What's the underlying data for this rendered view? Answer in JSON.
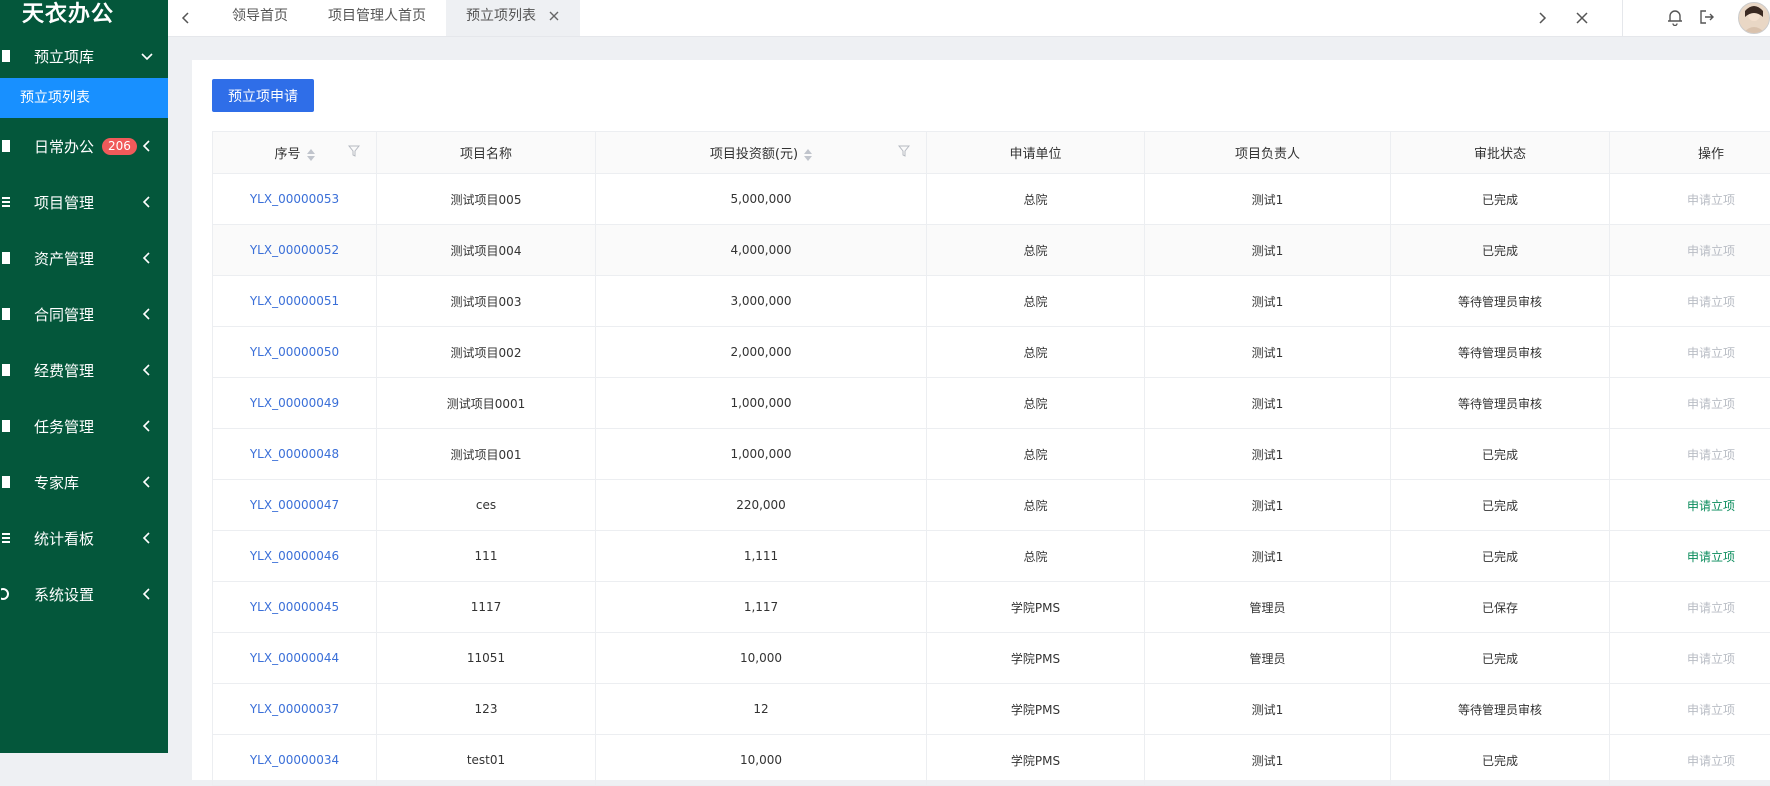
{
  "app": {
    "brand": "天衣办公"
  },
  "sidebar": {
    "items": [
      {
        "label": "预立项库",
        "icon": "book-icon",
        "expanded": true
      },
      {
        "label": "日常办公",
        "icon": "book-icon",
        "badge": "206"
      },
      {
        "label": "项目管理",
        "icon": "list-icon"
      },
      {
        "label": "资产管理",
        "icon": "book-icon"
      },
      {
        "label": "合同管理",
        "icon": "book-icon"
      },
      {
        "label": "经费管理",
        "icon": "book-icon"
      },
      {
        "label": "任务管理",
        "icon": "book-icon"
      },
      {
        "label": "专家库",
        "icon": "book-icon"
      },
      {
        "label": "统计看板",
        "icon": "list-icon"
      },
      {
        "label": "系统设置",
        "icon": "gear-icon"
      }
    ],
    "active_sub": "预立项列表"
  },
  "tabs": [
    {
      "label": "领导首页"
    },
    {
      "label": "项目管理人首页"
    },
    {
      "label": "预立项列表",
      "active": true
    }
  ],
  "toolbar": {
    "apply_label": "预立项申请"
  },
  "table": {
    "headers": {
      "seq": "序号",
      "name": "项目名称",
      "amount": "项目投资额(元)",
      "unit": "申请单位",
      "leader": "项目负责人",
      "status": "审批状态",
      "op": "操作"
    },
    "rows": [
      {
        "id": "YLX_00000053",
        "name": "测试项目005",
        "amount": "5,000,000",
        "unit": "总院",
        "leader": "测试1",
        "status": "已完成",
        "op": "申请立项",
        "op_enabled": false
      },
      {
        "id": "YLX_00000052",
        "name": "测试项目004",
        "amount": "4,000,000",
        "unit": "总院",
        "leader": "测试1",
        "status": "已完成",
        "op": "申请立项",
        "op_enabled": false
      },
      {
        "id": "YLX_00000051",
        "name": "测试项目003",
        "amount": "3,000,000",
        "unit": "总院",
        "leader": "测试1",
        "status": "等待管理员审核",
        "op": "申请立项",
        "op_enabled": false
      },
      {
        "id": "YLX_00000050",
        "name": "测试项目002",
        "amount": "2,000,000",
        "unit": "总院",
        "leader": "测试1",
        "status": "等待管理员审核",
        "op": "申请立项",
        "op_enabled": false
      },
      {
        "id": "YLX_00000049",
        "name": "测试项目0001",
        "amount": "1,000,000",
        "unit": "总院",
        "leader": "测试1",
        "status": "等待管理员审核",
        "op": "申请立项",
        "op_enabled": false
      },
      {
        "id": "YLX_00000048",
        "name": "测试项目001",
        "amount": "1,000,000",
        "unit": "总院",
        "leader": "测试1",
        "status": "已完成",
        "op": "申请立项",
        "op_enabled": false
      },
      {
        "id": "YLX_00000047",
        "name": "ces",
        "amount": "220,000",
        "unit": "总院",
        "leader": "测试1",
        "status": "已完成",
        "op": "申请立项",
        "op_enabled": true
      },
      {
        "id": "YLX_00000046",
        "name": "111",
        "amount": "1,111",
        "unit": "总院",
        "leader": "测试1",
        "status": "已完成",
        "op": "申请立项",
        "op_enabled": true
      },
      {
        "id": "YLX_00000045",
        "name": "1117",
        "amount": "1,117",
        "unit": "学院PMS",
        "leader": "管理员",
        "status": "已保存",
        "op": "申请立项",
        "op_enabled": false
      },
      {
        "id": "YLX_00000044",
        "name": "11051",
        "amount": "10,000",
        "unit": "学院PMS",
        "leader": "管理员",
        "status": "已完成",
        "op": "申请立项",
        "op_enabled": false
      },
      {
        "id": "YLX_00000037",
        "name": "123",
        "amount": "12",
        "unit": "学院PMS",
        "leader": "测试1",
        "status": "等待管理员审核",
        "op": "申请立项",
        "op_enabled": false
      },
      {
        "id": "YLX_00000034",
        "name": "test01",
        "amount": "10,000",
        "unit": "学院PMS",
        "leader": "测试1",
        "status": "已完成",
        "op": "申请立项",
        "op_enabled": false
      }
    ]
  },
  "colors": {
    "sidebar_bg": "#04573b",
    "active_sub_bg": "#1890ff",
    "primary": "#2f6ee8",
    "link": "#3a6fd8",
    "op_enabled": "#0a8c5c",
    "badge": "#f05a5a"
  }
}
